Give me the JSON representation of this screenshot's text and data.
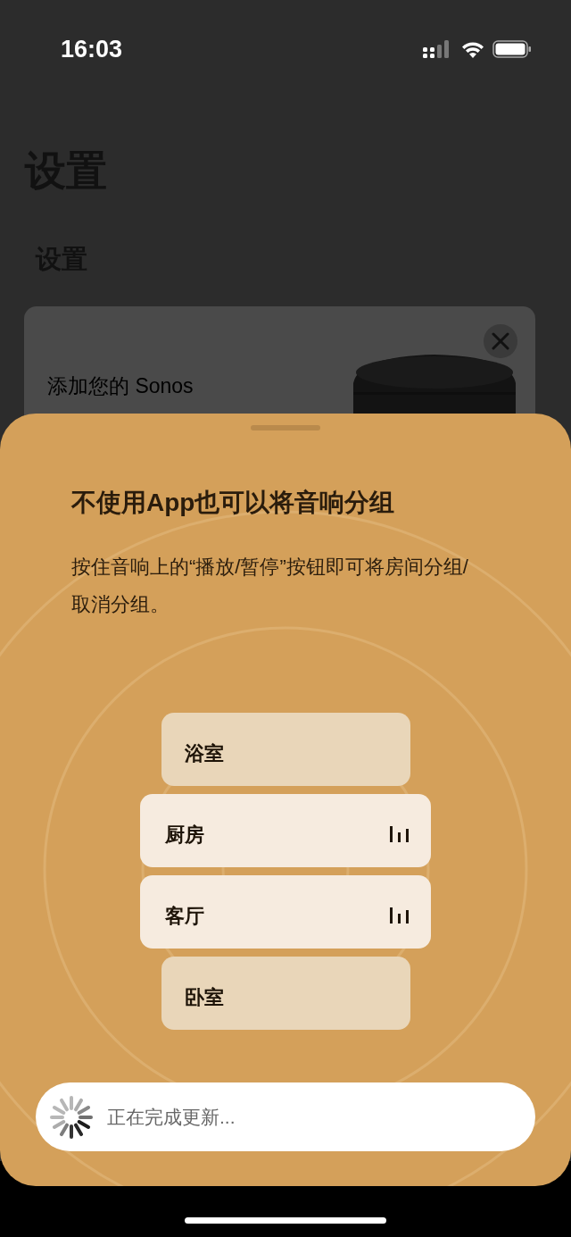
{
  "status_bar": {
    "time": "16:03"
  },
  "page": {
    "title": "设置",
    "section_title": "设置",
    "card": {
      "text": "添加您的 Sonos"
    }
  },
  "sheet": {
    "title": "不使用App也可以将音响分组",
    "body": "按住音响上的“播放/暂停”按钮即可将房间分组/取消分组。",
    "rooms": [
      {
        "name": "浴室",
        "selected": false
      },
      {
        "name": "厨房",
        "selected": true
      },
      {
        "name": "客厅",
        "selected": true
      },
      {
        "name": "卧室",
        "selected": false
      }
    ],
    "status": {
      "text": "正在完成更新..."
    }
  }
}
